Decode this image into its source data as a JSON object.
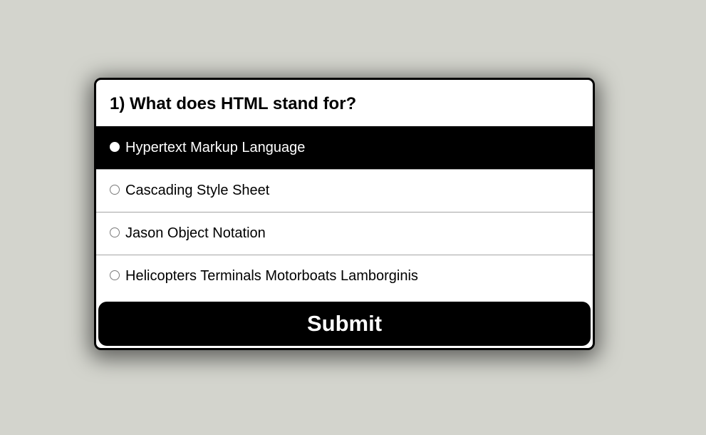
{
  "quiz": {
    "question": "1) What does HTML stand for?",
    "answers": [
      {
        "label": "Hypertext Markup Language",
        "highlighted": true
      },
      {
        "label": "Cascading Style Sheet",
        "highlighted": false
      },
      {
        "label": "Jason Object Notation",
        "highlighted": false
      },
      {
        "label": "Helicopters Terminals Motorboats Lamborginis",
        "highlighted": false
      }
    ],
    "submit_label": "Submit"
  },
  "colors": {
    "background": "#d3d4cd",
    "card": "#ffffff",
    "accent": "#000000",
    "divider": "#a5a5a5"
  }
}
